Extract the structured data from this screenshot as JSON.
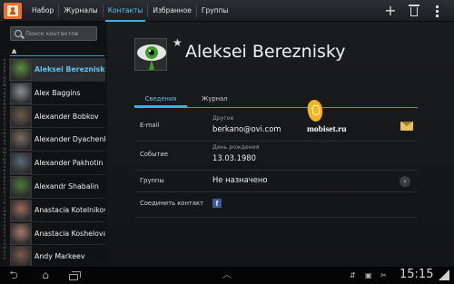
{
  "topbar": {
    "tabs": [
      {
        "label": "Набор",
        "active": false
      },
      {
        "label": "Журналы",
        "active": false
      },
      {
        "label": "Контакты",
        "active": true
      },
      {
        "label": "Избранное",
        "active": false
      },
      {
        "label": "Группы",
        "active": false
      }
    ],
    "actions": {
      "add": "+",
      "menu": "⋮"
    }
  },
  "contacts": {
    "search_placeholder": "Поиск контактов",
    "section": "A",
    "alphabet": [
      "#",
      "А",
      "Б",
      "В",
      "Г",
      "Д",
      "Е",
      "Ж",
      "З",
      "И",
      "К",
      "Л",
      "М",
      "Н",
      "О",
      "П",
      "Р",
      "С",
      "Т",
      "У",
      "Ф",
      "Х",
      "Ц",
      "Ч",
      "Ш",
      "Щ",
      "Э",
      "Ю",
      "Я",
      "A",
      "B",
      "C",
      "D",
      "E",
      "F",
      "G",
      "H",
      "I",
      "J",
      "K",
      "L",
      "M",
      "N",
      "O",
      "P",
      "Q",
      "R",
      "S",
      "T",
      "U",
      "V",
      "W",
      "X",
      "Y",
      "Z"
    ],
    "items": [
      {
        "name": "Aleksei Bereznisky",
        "selected": true,
        "color": "#5a8f3a"
      },
      {
        "name": "Alex Baggins",
        "selected": false,
        "color": "#8a8f96"
      },
      {
        "name": "Alexander Bobkov",
        "selected": false,
        "color": "#6b5b4a"
      },
      {
        "name": "Alexander Dyachenko",
        "selected": false,
        "color": "#7a6a5c"
      },
      {
        "name": "Alexander Pakhotin",
        "selected": false,
        "color": "#556a7a"
      },
      {
        "name": "Alexandr Shabalin",
        "selected": false,
        "color": "#4a7a3a"
      },
      {
        "name": "Anastacia Kotelnikova",
        "selected": false,
        "color": "#9a6a5a"
      },
      {
        "name": "Anastacia Koshelova",
        "selected": false,
        "color": "#a67a6a"
      },
      {
        "name": "Andy Markeev",
        "selected": false,
        "color": "#7a5a4a"
      }
    ]
  },
  "detail": {
    "name": "Aleksei Bereznisky",
    "tabs": {
      "info": "Сведения",
      "log": "Журнал"
    },
    "email": {
      "label": "E-mail",
      "type": "Другое",
      "value": "berkano@ovi.com",
      "action_icon": "send-email-icon"
    },
    "event": {
      "label": "Событие",
      "type": "День рождения",
      "value": "13.03.1980"
    },
    "groups": {
      "label": "Группы",
      "value": "Не назначено",
      "action_icon": "chevron-right-icon"
    },
    "link": {
      "label": "Соединить контакт",
      "account_icon": "facebook-icon",
      "account_glyph": "f"
    }
  },
  "watermark": {
    "text": "mobiset.ru"
  },
  "statusbar": {
    "time": "15:15",
    "up_glyph": "︿"
  }
}
